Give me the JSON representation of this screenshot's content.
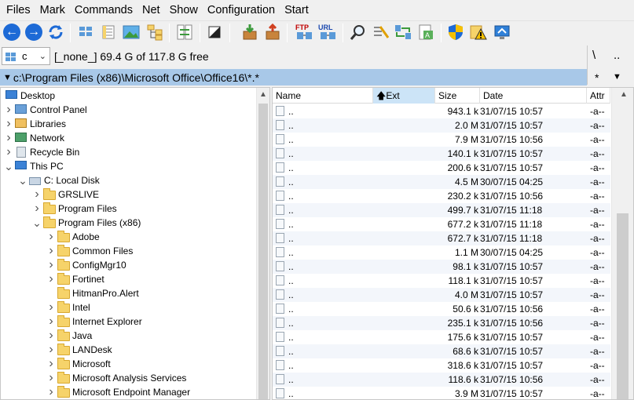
{
  "menu": [
    "Files",
    "Mark",
    "Commands",
    "Net",
    "Show",
    "Configuration",
    "Start"
  ],
  "toolbar": {
    "ftp_label": "FTP",
    "url_label": "URL"
  },
  "drive": {
    "selected": "c",
    "info": "[_none_]  69.4 G of 117.8 G free",
    "root_btn": "\\",
    "up_btn": ".."
  },
  "path": {
    "current": "c:\\Program Files (x86)\\Microsoft Office\\Office16\\*.*",
    "filter": "*"
  },
  "tree": {
    "items": [
      {
        "label": "Desktop",
        "icon": "desktop-icon",
        "expand": ""
      },
      {
        "label": "Control Panel",
        "icon": "control-panel-icon",
        "expand": ">"
      },
      {
        "label": "Libraries",
        "icon": "library-icon",
        "expand": ">"
      },
      {
        "label": "Network",
        "icon": "network-icon",
        "expand": ">"
      },
      {
        "label": "Recycle Bin",
        "icon": "recycle-bin-icon",
        "expand": ">"
      },
      {
        "label": "This PC",
        "icon": "computer-icon",
        "expand": "v"
      },
      {
        "label": "C:  Local Disk",
        "icon": "drive-icon",
        "expand": "v"
      },
      {
        "label": "GRSLIVE",
        "icon": "folder-icon",
        "expand": ">"
      },
      {
        "label": "Program Files",
        "icon": "folder-icon",
        "expand": ">"
      },
      {
        "label": "Program Files (x86)",
        "icon": "folder-icon",
        "expand": "v"
      },
      {
        "label": "Adobe",
        "icon": "folder-icon",
        "expand": ">"
      },
      {
        "label": "Common Files",
        "icon": "folder-icon",
        "expand": ">"
      },
      {
        "label": "ConfigMgr10",
        "icon": "folder-icon",
        "expand": ">"
      },
      {
        "label": "Fortinet",
        "icon": "folder-icon",
        "expand": ">"
      },
      {
        "label": "HitmanPro.Alert",
        "icon": "folder-icon",
        "expand": ""
      },
      {
        "label": "Intel",
        "icon": "folder-icon",
        "expand": ">"
      },
      {
        "label": "Internet Explorer",
        "icon": "folder-icon",
        "expand": ">"
      },
      {
        "label": "Java",
        "icon": "folder-icon",
        "expand": ">"
      },
      {
        "label": "LANDesk",
        "icon": "folder-icon",
        "expand": ">"
      },
      {
        "label": "Microsoft",
        "icon": "folder-icon",
        "expand": ">"
      },
      {
        "label": "Microsoft Analysis Services",
        "icon": "folder-icon",
        "expand": ">"
      },
      {
        "label": "Microsoft Endpoint Manager",
        "icon": "folder-icon",
        "expand": ">"
      }
    ]
  },
  "file_list": {
    "columns": {
      "name": "Name",
      "ext": "Ext",
      "size": "Size",
      "date": "Date",
      "attr": "Attr"
    },
    "sorted_column": "ext",
    "rows": [
      {
        "name": "..",
        "size": "943.1 k",
        "date": "31/07/15 10:57",
        "attr": "-a--"
      },
      {
        "name": "..",
        "size": "2.0 M",
        "date": "31/07/15 10:57",
        "attr": "-a--"
      },
      {
        "name": "..",
        "size": "7.9 M",
        "date": "31/07/15 10:56",
        "attr": "-a--"
      },
      {
        "name": "..",
        "size": "140.1 k",
        "date": "31/07/15 10:57",
        "attr": "-a--"
      },
      {
        "name": "..",
        "size": "200.6 k",
        "date": "31/07/15 10:57",
        "attr": "-a--"
      },
      {
        "name": "..",
        "size": "4.5 M",
        "date": "30/07/15 04:25",
        "attr": "-a--"
      },
      {
        "name": "..",
        "size": "230.2 k",
        "date": "31/07/15 10:56",
        "attr": "-a--"
      },
      {
        "name": "..",
        "size": "499.7 k",
        "date": "31/07/15 11:18",
        "attr": "-a--"
      },
      {
        "name": "..",
        "size": "677.2 k",
        "date": "31/07/15 11:18",
        "attr": "-a--"
      },
      {
        "name": "..",
        "size": "672.7 k",
        "date": "31/07/15 11:18",
        "attr": "-a--"
      },
      {
        "name": "..",
        "size": "1.1 M",
        "date": "30/07/15 04:25",
        "attr": "-a--"
      },
      {
        "name": "..",
        "size": "98.1 k",
        "date": "31/07/15 10:57",
        "attr": "-a--"
      },
      {
        "name": "..",
        "size": "118.1 k",
        "date": "31/07/15 10:57",
        "attr": "-a--"
      },
      {
        "name": "..",
        "size": "4.0 M",
        "date": "31/07/15 10:57",
        "attr": "-a--"
      },
      {
        "name": "..",
        "size": "50.6 k",
        "date": "31/07/15 10:56",
        "attr": "-a--"
      },
      {
        "name": "..",
        "size": "235.1 k",
        "date": "31/07/15 10:56",
        "attr": "-a--"
      },
      {
        "name": "..",
        "size": "175.6 k",
        "date": "31/07/15 10:57",
        "attr": "-a--"
      },
      {
        "name": "..",
        "size": "68.6 k",
        "date": "31/07/15 10:57",
        "attr": "-a--"
      },
      {
        "name": "..",
        "size": "318.6 k",
        "date": "31/07/15 10:57",
        "attr": "-a--"
      },
      {
        "name": "..",
        "size": "118.6 k",
        "date": "31/07/15 10:56",
        "attr": "-a--"
      },
      {
        "name": "..",
        "size": "3.9 M",
        "date": "31/07/15 10:57",
        "attr": "-a--"
      }
    ]
  },
  "colors": {
    "path_bar": "#a8c8e8",
    "sorted_header": "#cce4f7",
    "accent_blue": "#1d6ad6"
  }
}
